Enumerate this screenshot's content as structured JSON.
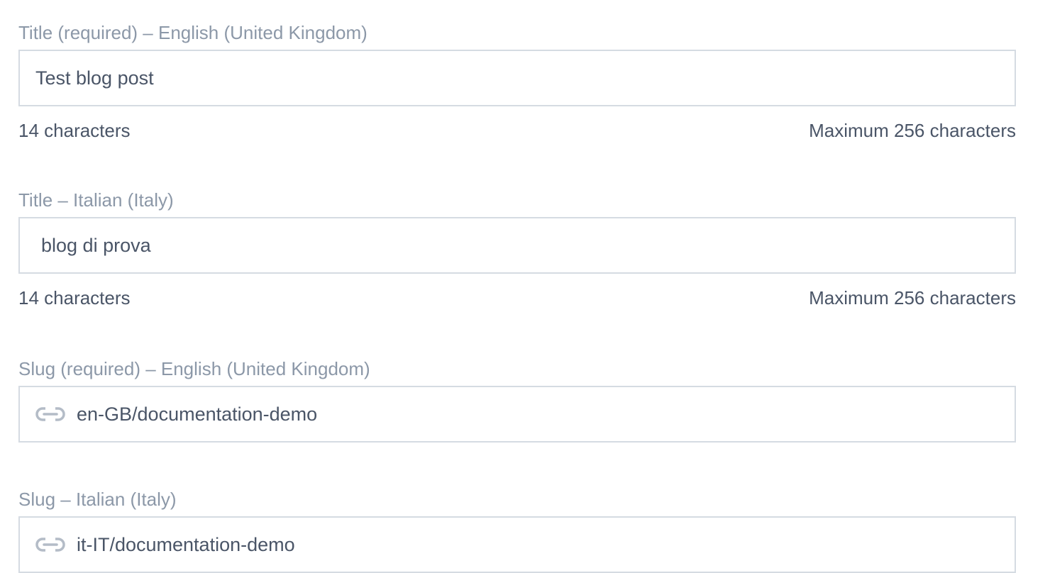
{
  "fields": [
    {
      "label": "Title (required) – English (United Kingdom)",
      "value": "Test blog post",
      "count": "14 characters",
      "max": "Maximum 256 characters"
    },
    {
      "label": "Title – Italian (Italy)",
      "value": "blog di prova",
      "count": "14 characters",
      "max": "Maximum 256 characters"
    },
    {
      "label": "Slug (required) – English (United Kingdom)",
      "value": "en-GB/documentation-demo",
      "icon": "link-icon"
    },
    {
      "label": "Slug – Italian (Italy)",
      "value": "it-IT/documentation-demo",
      "icon": "link-icon"
    }
  ],
  "colors": {
    "label": "#8c98a8",
    "text": "#4a5567",
    "border": "#d5dbe2",
    "icon": "#b4bcc7"
  }
}
